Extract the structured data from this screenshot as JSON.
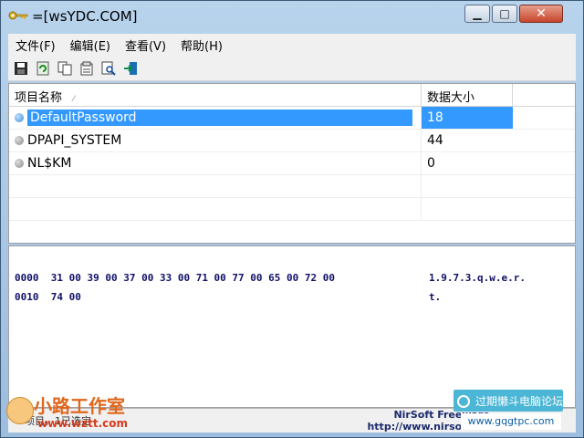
{
  "window": {
    "title": "=[wsYDC.COM]"
  },
  "menu": [
    "文件(F)",
    "编辑(E)",
    "查看(V)",
    "帮助(H)"
  ],
  "toolbar": [
    "save-icon",
    "refresh-icon",
    "copy-icon",
    "properties-icon",
    "find-icon",
    "exit-icon"
  ],
  "list": {
    "columns": [
      "项目名称",
      "数据大小"
    ],
    "rows": [
      {
        "name": "DefaultPassword",
        "size": "18",
        "selected": true
      },
      {
        "name": "DPAPI_SYSTEM",
        "size": "44",
        "selected": false
      },
      {
        "name": "NL$KM",
        "size": "0",
        "selected": false
      }
    ]
  },
  "hex": {
    "lines": [
      {
        "offset": "0000",
        "bytes": "31 00 39 00 37 00 33 00 71 00 77 00 65 00 72 00",
        "ascii": "1.9.7.3.q.w.e.r."
      },
      {
        "offset": "0010",
        "bytes": "74 00",
        "ascii": "t."
      }
    ]
  },
  "status": {
    "left": "项目，1已选定",
    "right": "NirSoft Freeware.  http://www.nirsoft.net"
  },
  "watermark": {
    "logo_title": "小路工作室",
    "logo_url": "www.wztt.com",
    "badge_title": "过期懒斗电脑论坛",
    "badge_url": "www.gqgtpc.com"
  },
  "colors": {
    "selection": "#3399ff",
    "hex_text": "#10106a",
    "statusbar_link": "#1a2a6c"
  }
}
